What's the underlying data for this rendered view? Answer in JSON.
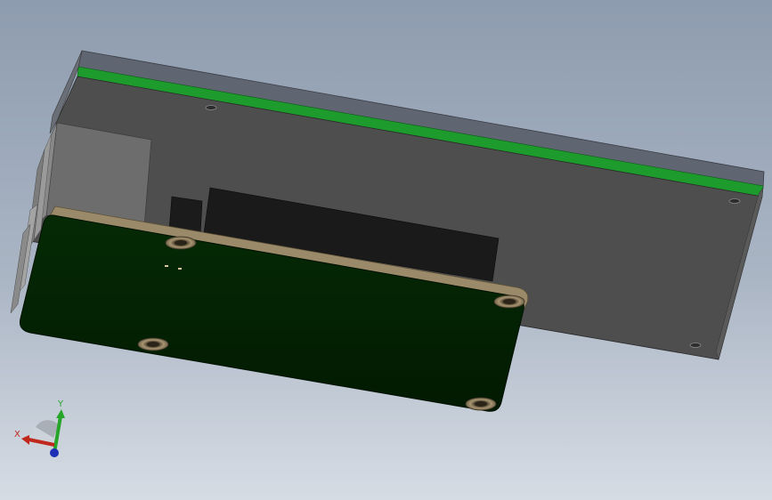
{
  "axis_triad": {
    "x_label": "X",
    "y_label": "Y",
    "colors": {
      "x": "#c0281d",
      "y": "#27a52a",
      "z": "#1d2fb4"
    }
  },
  "colors": {
    "background_top": "#8f9db0",
    "background_bottom": "#d3d9e1",
    "enclosure_face": "#4f4f4f",
    "enclosure_top_edge": "#5e6470",
    "green_stripe": "#1d9c2d",
    "pcb": "#032103",
    "pcb_edge": "#9a8a6c",
    "mount_hole": "#8a7a5c",
    "connector_gray": "#6b6b6b",
    "chip_black": "#1a1a1a"
  }
}
